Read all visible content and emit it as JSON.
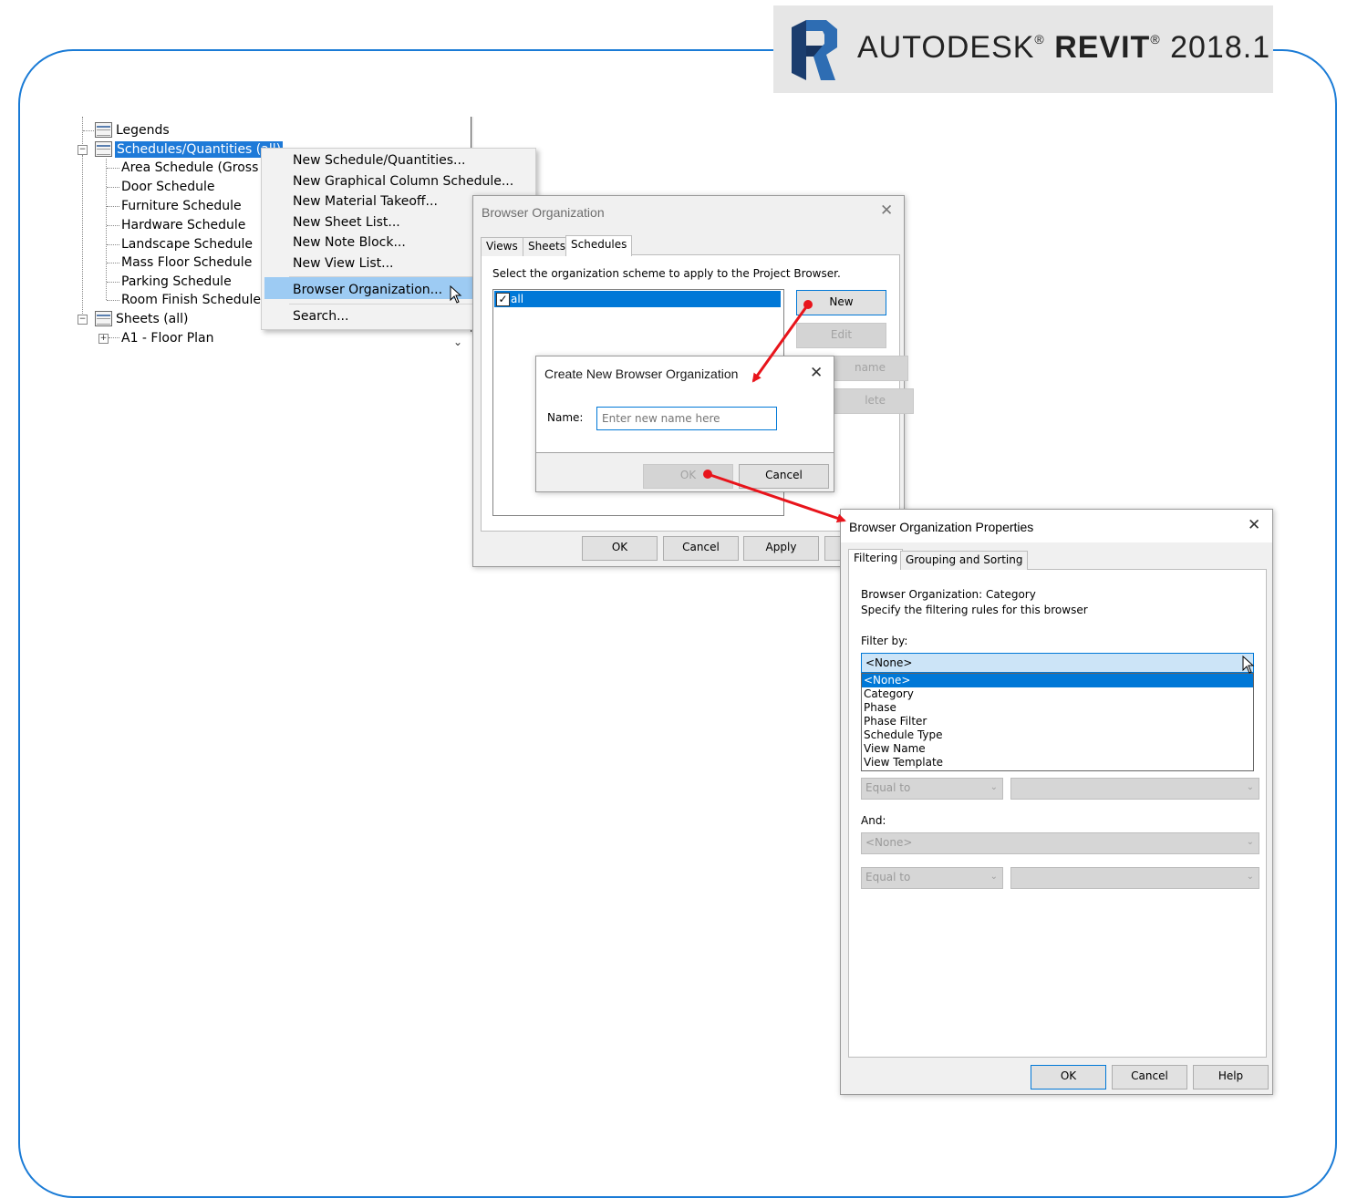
{
  "branding": {
    "brand": "AUTODESK",
    "product": "REVIT",
    "version": "2018.1",
    "reg": "®"
  },
  "tree": {
    "items": [
      {
        "label": "Legends"
      },
      {
        "label": "Schedules/Quantities (all)"
      },
      {
        "label": "Area Schedule (Gross Bu"
      },
      {
        "label": "Door Schedule"
      },
      {
        "label": "Furniture Schedule"
      },
      {
        "label": "Hardware Schedule"
      },
      {
        "label": "Landscape Schedule"
      },
      {
        "label": "Mass Floor Schedule"
      },
      {
        "label": "Parking Schedule"
      },
      {
        "label": "Room Finish Schedule"
      },
      {
        "label": "Sheets (all)"
      },
      {
        "label": "A1 - Floor Plan"
      }
    ]
  },
  "context_menu": {
    "items": [
      "New Schedule/Quantities...",
      "New Graphical Column Schedule...",
      "New Material Takeoff...",
      "New Sheet List...",
      "New Note Block...",
      "New View List...",
      "Browser Organization...",
      "Search..."
    ]
  },
  "browser_org": {
    "title": "Browser Organization",
    "tabs": [
      "Views",
      "Sheets",
      "Schedules"
    ],
    "active_tab": "Schedules",
    "instruction": "Select the organization scheme to apply to the Project Browser.",
    "schemes": [
      {
        "label": "all",
        "checked": true
      }
    ],
    "buttons": {
      "new": "New",
      "edit": "Edit",
      "rename_partial": "name",
      "delete_partial": "lete"
    },
    "footer": {
      "ok": "OK",
      "cancel": "Cancel",
      "apply": "Apply"
    }
  },
  "create_dialog": {
    "title": "Create New Browser Organization",
    "name_label": "Name:",
    "name_placeholder": "Enter new name here",
    "ok": "OK",
    "cancel": "Cancel"
  },
  "props_dialog": {
    "title": "Browser Organization Properties",
    "tabs": [
      "Filtering",
      "Grouping and Sorting"
    ],
    "active_tab": "Filtering",
    "org_line": "Browser Organization: Category",
    "desc": "Specify the filtering rules for this browser",
    "filter_by_label": "Filter by:",
    "filter_selected": "<None>",
    "dropdown_options": [
      "<None>",
      "Category",
      "Phase",
      "Phase Filter",
      "Schedule Type",
      "View Name",
      "View Template"
    ],
    "equal_to_1": "Equal to",
    "and_label": "And:",
    "and_value": "<None>",
    "equal_to_2": "Equal to",
    "footer": {
      "ok": "OK",
      "cancel": "Cancel",
      "help": "Help"
    }
  },
  "colors": {
    "frame": "#1a7bd6",
    "selection": "#1e7ad8",
    "menu_highlight": "#9dcbf3",
    "arrow": "#e8141b"
  }
}
